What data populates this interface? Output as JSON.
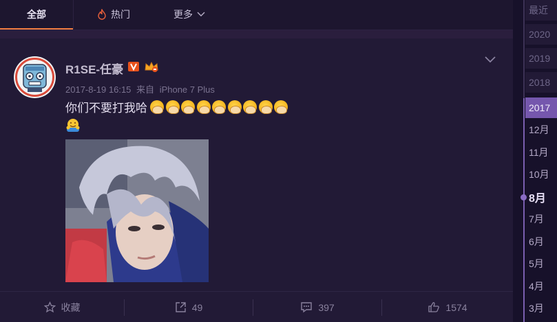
{
  "tabs": {
    "all_label": "全部",
    "hot_label": "热门",
    "more_label": "更多"
  },
  "post": {
    "username": "R1SE-任豪",
    "timestamp": "2017-8-19 16:15",
    "source_prefix": "来自",
    "source_device": "iPhone 7 Plus",
    "text": "你们不要打我哈",
    "emoji_count": 9,
    "photo_icon": "selfie-photo"
  },
  "actions": {
    "favorite_label": "收藏",
    "repost_count": "49",
    "comment_count": "397",
    "like_count": "1574"
  },
  "timeline": {
    "years": [
      "最近",
      "2020",
      "2019",
      "2018",
      "2017"
    ],
    "active_year": "2017",
    "months": [
      "12月",
      "11月",
      "10月",
      "8月",
      "7月",
      "6月",
      "5月",
      "4月",
      "3月"
    ],
    "current_month": "8月"
  },
  "colors": {
    "accent_orange": "#f07c41",
    "timeline_active": "#7557ad",
    "verified_badge": "#e8521c",
    "background": "#1c1530"
  }
}
